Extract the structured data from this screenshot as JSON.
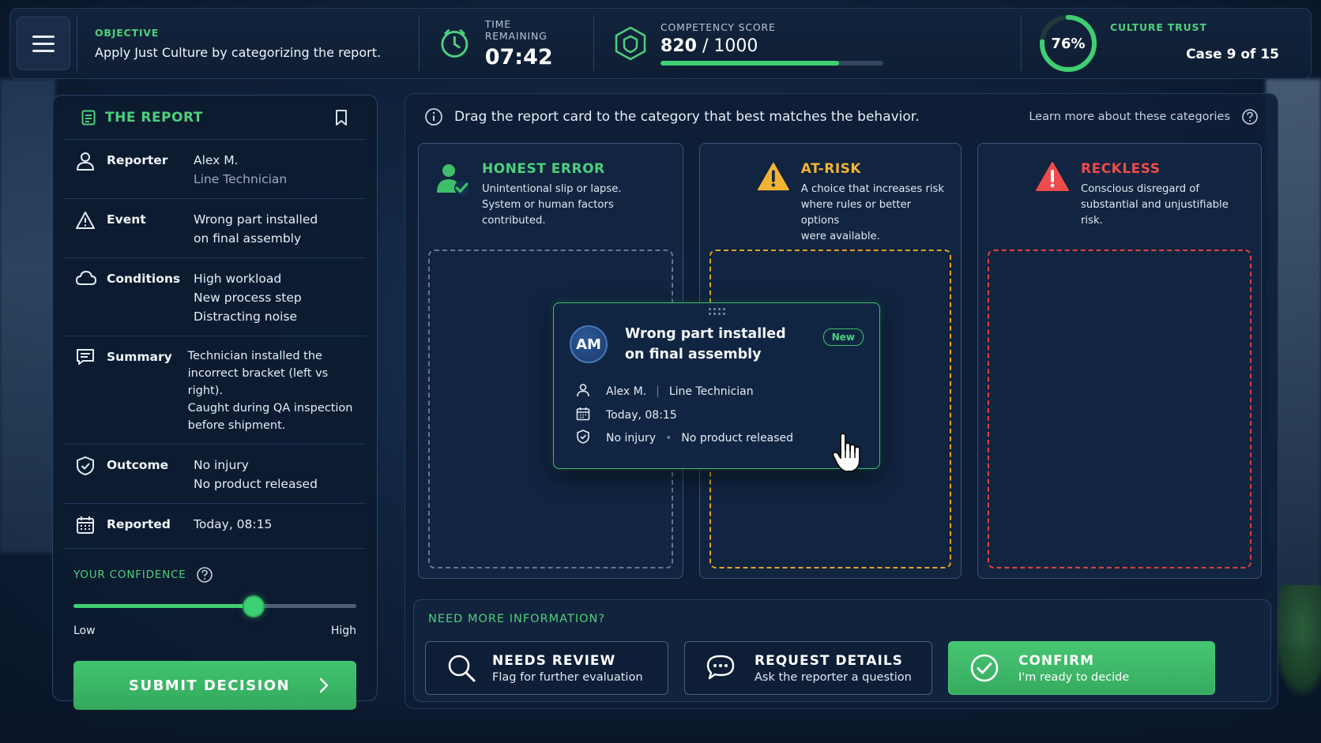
{
  "topbar": {
    "objective_label": "OBJECTIVE",
    "objective_text": "Apply Just Culture by categorizing the report.",
    "time_label": "TIME REMAINING",
    "time_value": "07:42",
    "score_label": "COMPETENCY SCORE",
    "score_value": "820",
    "score_max": "/ 1000",
    "score_progress": 0.8,
    "trust_label": "CULTURE TRUST",
    "trust_value": "76%",
    "trust_fraction": 0.76,
    "case_text": "Case 9 of 15"
  },
  "report": {
    "title": "THE REPORT",
    "rows": [
      {
        "icon": "person-icon",
        "key": "Reporter",
        "lines": [
          "Alex M.",
          "Line Technician"
        ]
      },
      {
        "icon": "warning-icon",
        "key": "Event",
        "lines": [
          "Wrong part installed",
          "on final assembly"
        ]
      },
      {
        "icon": "cloud-icon",
        "key": "Conditions",
        "lines": [
          "High workload",
          "New process step",
          "Distracting noise"
        ]
      },
      {
        "icon": "message-icon",
        "key": "Summary",
        "lines": [
          "Technician installed the",
          "incorrect bracket (left vs right).",
          "Caught during QA inspection",
          "before shipment."
        ]
      },
      {
        "icon": "shield-icon",
        "key": "Outcome",
        "lines": [
          "No injury",
          "No product released"
        ]
      },
      {
        "icon": "calendar-icon",
        "key": "Reported",
        "lines": [
          "Today, 08:15"
        ]
      }
    ],
    "confidence_label": "YOUR CONFIDENCE",
    "confidence_value": 0.7,
    "low_label": "Low",
    "high_label": "High",
    "submit_label": "SUBMIT DECISION"
  },
  "board": {
    "instruction": "Drag the report card to the category that best matches the behavior.",
    "learn_more": "Learn more about these categories",
    "categories": [
      {
        "id": "honest",
        "title": "HONEST ERROR",
        "desc": [
          "Unintentional slip or lapse.",
          "System or human factors",
          "contributed."
        ],
        "color": "#4cd07d",
        "icon": "person-check-icon"
      },
      {
        "id": "atrisk",
        "title": "AT-RISK",
        "desc": [
          "A choice that increases risk",
          "where rules or better options",
          "were available."
        ],
        "color": "#f2b233",
        "icon": "warning-icon"
      },
      {
        "id": "reckless",
        "title": "RECKLESS",
        "desc": [
          "Conscious disregard of",
          "substantial and unjustifiable",
          "risk."
        ],
        "color": "#ef4b4b",
        "icon": "alert-triangle-icon"
      }
    ]
  },
  "card": {
    "initials": "AM",
    "title_line1": "Wrong part installed",
    "title_line2": "on final assembly",
    "badge": "New",
    "reporter": "Alex M.",
    "role": "Line Technician",
    "time": "Today, 08:15",
    "outcome1": "No injury",
    "outcome2": "No product released"
  },
  "more": {
    "label": "NEED MORE INFORMATION?",
    "actions": [
      {
        "icon": "search-icon",
        "title": "NEEDS REVIEW",
        "sub": "Flag for further evaluation"
      },
      {
        "icon": "chat-icon",
        "title": "REQUEST DETAILS",
        "sub": "Ask the reporter a question"
      },
      {
        "icon": "check-circle-icon",
        "title": "CONFIRM",
        "sub": "I'm ready to decide"
      }
    ]
  },
  "colors": {
    "accent": "#4cd07d",
    "warning": "#f2b233",
    "danger": "#ef4b4b",
    "panel": "#0e1e34"
  }
}
